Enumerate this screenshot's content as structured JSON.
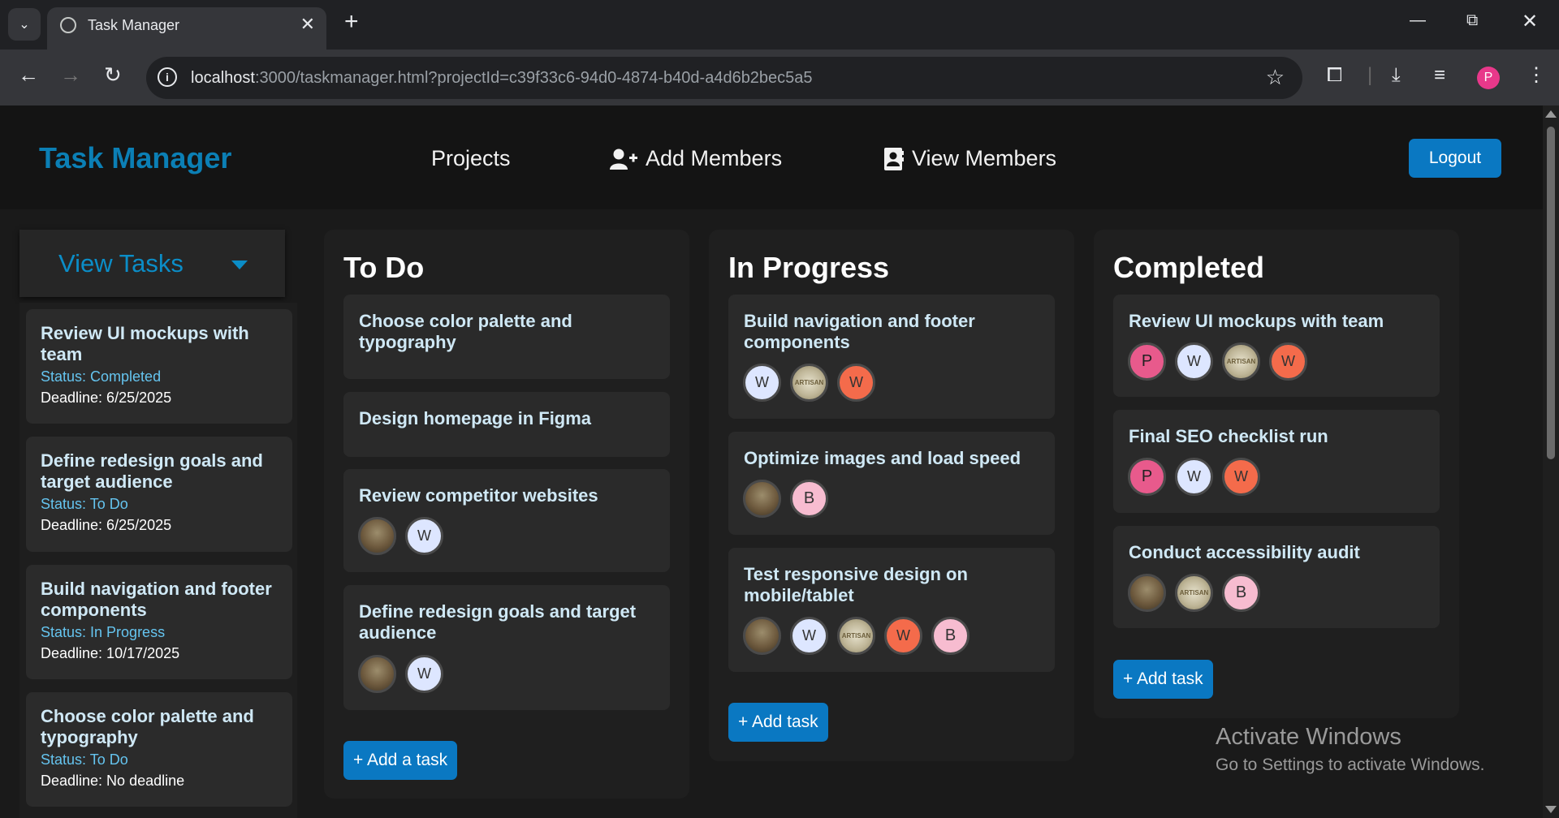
{
  "browser": {
    "tab_title": "Task Manager",
    "url_host": "localhost",
    "url_rest": ":3000/taskmanager.html?projectId=c39f33c6-94d0-4874-b40d-a4d6b2bec5a5",
    "profile_initial": "P"
  },
  "header": {
    "brand": "Task Manager",
    "nav": {
      "projects": "Projects",
      "add_members": "Add Members",
      "view_members": "View Members"
    },
    "logout": "Logout"
  },
  "sidebar": {
    "title": "View Tasks",
    "tasks": [
      {
        "title": "Review UI mockups with team",
        "status": "Status: Completed",
        "deadline": "Deadline: 6/25/2025"
      },
      {
        "title": "Define redesign goals and target audience",
        "status": "Status: To Do",
        "deadline": "Deadline: 6/25/2025"
      },
      {
        "title": "Build navigation and footer components",
        "status": "Status: In Progress",
        "deadline": "Deadline: 10/17/2025"
      },
      {
        "title": "Choose color palette and typography",
        "status": "Status: To Do",
        "deadline": "Deadline: No deadline"
      }
    ]
  },
  "columns": {
    "todo": {
      "title": "To Do",
      "add_label": "+ Add a task",
      "cards": [
        {
          "title": "Choose color palette and typography"
        },
        {
          "title": "Design homepage in Figma"
        },
        {
          "title": "Review competitor websites",
          "avatars": [
            "",
            "W"
          ]
        },
        {
          "title": "Define redesign goals and target audience",
          "avatars": [
            "",
            "W"
          ]
        }
      ]
    },
    "inprogress": {
      "title": "In Progress",
      "add_label": "+ Add task",
      "cards": [
        {
          "title": "Build navigation and footer components",
          "avatars": [
            "W",
            "",
            "W"
          ]
        },
        {
          "title": "Optimize images and load speed",
          "avatars": [
            "",
            "B"
          ]
        },
        {
          "title": "Test responsive design on mobile/tablet",
          "avatars": [
            "",
            "W",
            "",
            "W",
            "B"
          ]
        }
      ]
    },
    "completed": {
      "title": "Completed",
      "add_label": "+ Add task",
      "cards": [
        {
          "title": "Review UI mockups with team",
          "avatars": [
            "P",
            "W",
            "",
            "W"
          ]
        },
        {
          "title": "Final SEO checklist run",
          "avatars": [
            "P",
            "W",
            "W"
          ]
        },
        {
          "title": "Conduct accessibility audit",
          "avatars": [
            "",
            "",
            "B"
          ]
        }
      ]
    }
  },
  "seal_text": "ARTISAN",
  "watermark": {
    "line1": "Activate Windows",
    "line2": "Go to Settings to activate Windows."
  },
  "colors": {
    "brand": "#0b7fb5",
    "primary_button": "#0a78c2",
    "status_text": "#65c4ef"
  }
}
